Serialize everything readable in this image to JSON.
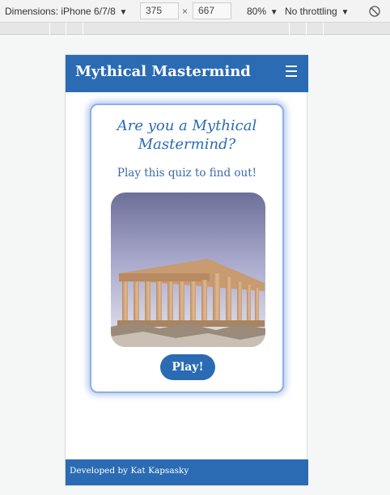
{
  "devtools": {
    "device_label": "Dimensions: iPhone 6/7/8",
    "width_value": "375",
    "height_value": "667",
    "times": "×",
    "zoom": "80%",
    "throttling": "No throttling"
  },
  "navbar": {
    "brand": "Mythical Mastermind",
    "menu_icon": "hamburger-icon"
  },
  "card": {
    "title": "Are you a Mythical Mastermind?",
    "subtitle": "Play this quiz to find out!",
    "image_icon": "parthenon-image",
    "play_label": "Play!"
  },
  "footer": {
    "text": "Developed by Kat Kapsasky"
  },
  "colors": {
    "brand_blue": "#2a6bb3",
    "card_glow": "#8db1e0"
  }
}
